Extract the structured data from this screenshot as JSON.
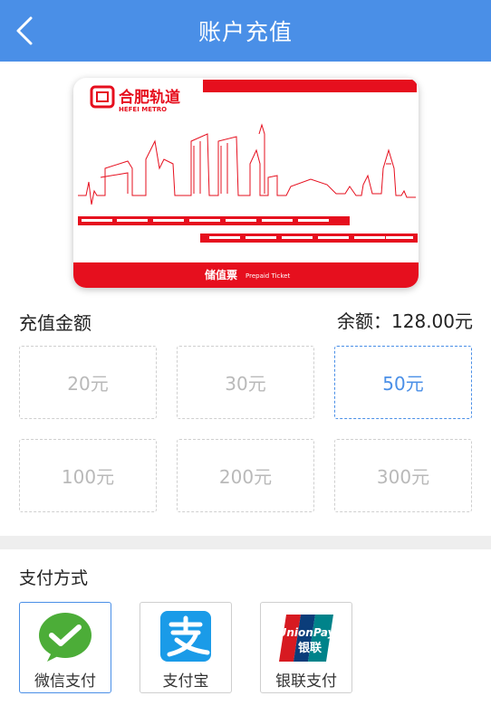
{
  "header": {
    "title": "账户充值"
  },
  "card": {
    "brand_cn": "合肥轨道",
    "brand_en": "HEFEI METRO",
    "ticket_cn": "储值票",
    "ticket_en": "Prepaid Ticket"
  },
  "recharge": {
    "label": "充值金额",
    "balance": "余额：128.00元",
    "options": [
      "20元",
      "30元",
      "50元",
      "100元",
      "200元",
      "300元"
    ],
    "selected": "50元"
  },
  "payment": {
    "label": "支付方式",
    "methods": [
      "微信支付",
      "支付宝",
      "银联支付"
    ],
    "selected": "微信支付",
    "unionpay_logo": {
      "line1": "UnionPay",
      "line2": "银联"
    }
  },
  "colors": {
    "accent": "#4a8fe7",
    "metro_red": "#e60f1e",
    "wechat": "#4cad38",
    "alipay": "#1a9be8"
  }
}
